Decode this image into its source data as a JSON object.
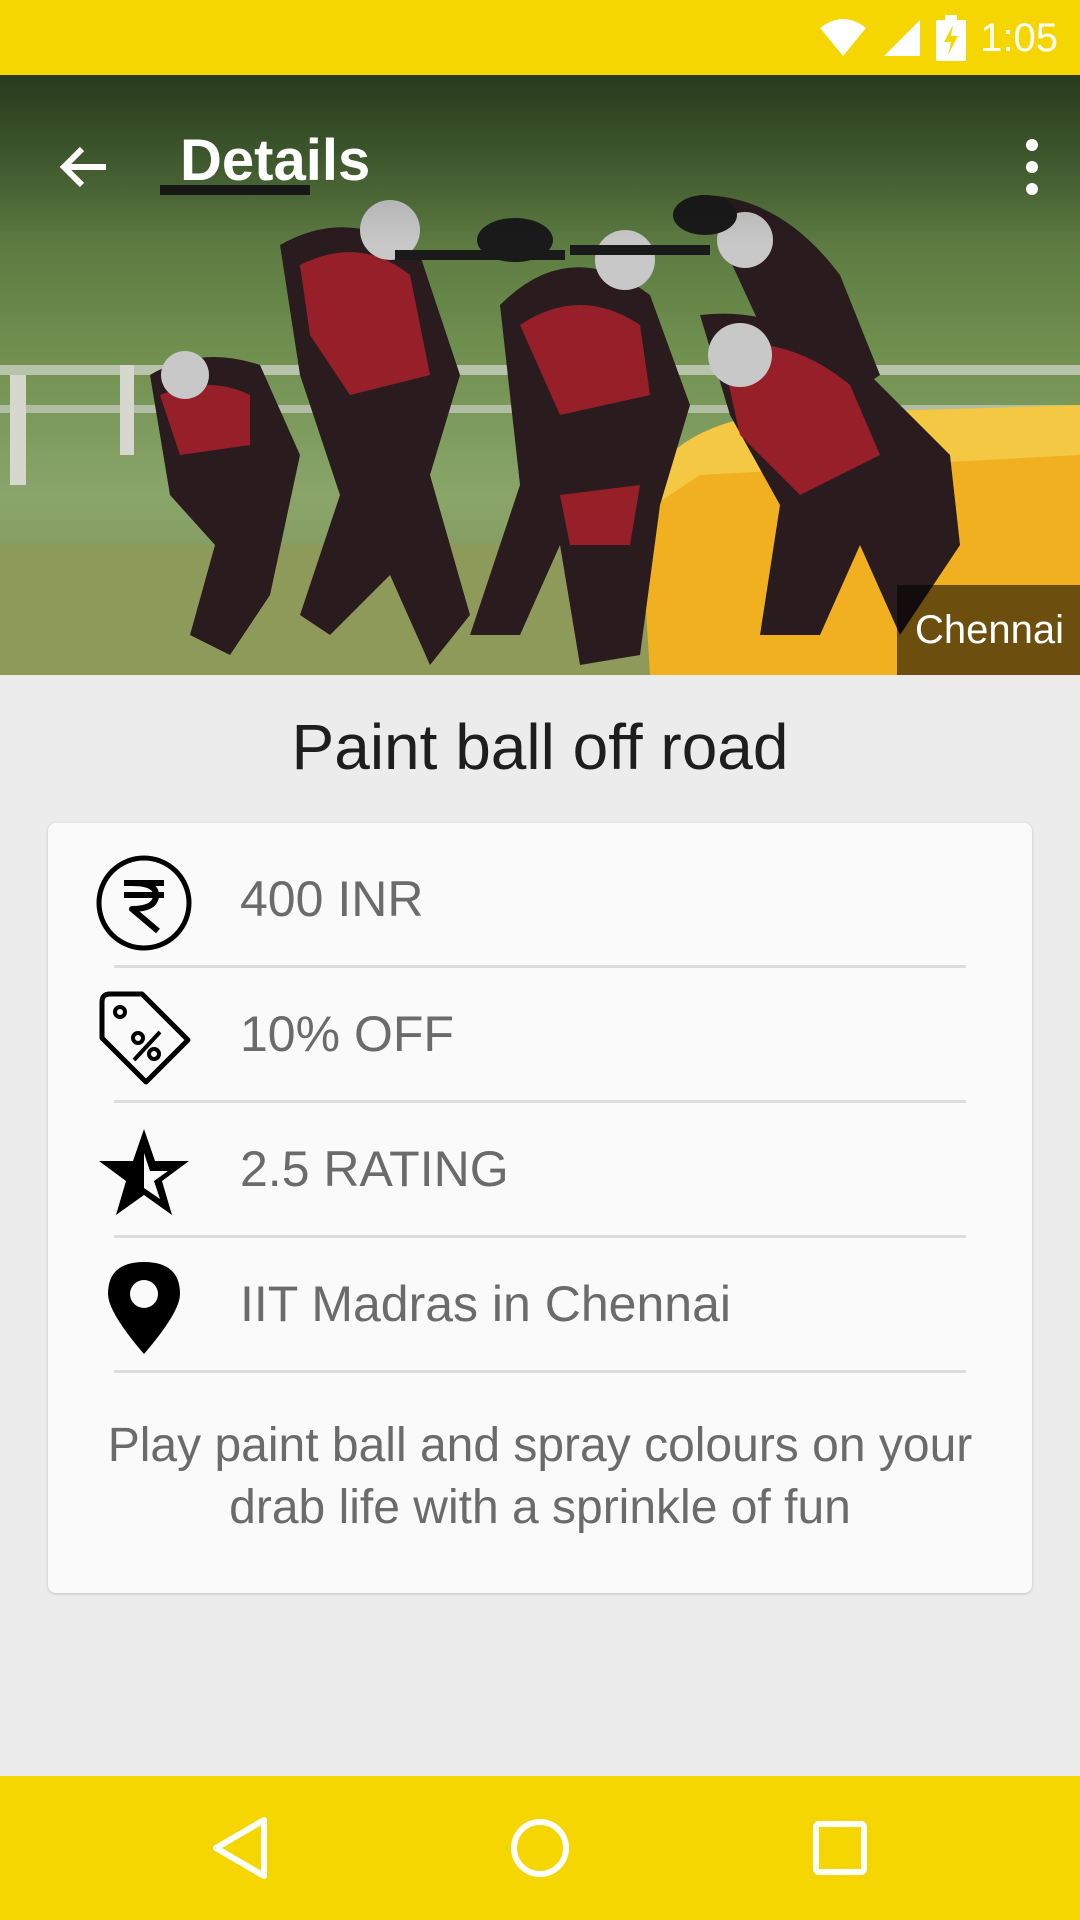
{
  "status_bar": {
    "time": "1:05",
    "icons": [
      "wifi-icon",
      "signal-icon",
      "battery-charging-icon"
    ],
    "color": "#f5d600"
  },
  "app_bar": {
    "title": "Details",
    "back_icon": "arrow-back-icon",
    "menu_icon": "more-vert-icon"
  },
  "hero": {
    "city": "Chennai"
  },
  "activity": {
    "title": "Paint ball off road",
    "details": [
      {
        "icon": "rupee-icon",
        "text": "400 INR"
      },
      {
        "icon": "discount-tag-icon",
        "text": "10% OFF"
      },
      {
        "icon": "star-half-icon",
        "text": "2.5 RATING"
      },
      {
        "icon": "location-pin-icon",
        "text": "IIT Madras in Chennai"
      }
    ],
    "description": "Play paint ball and spray colours on your drab life with a sprinkle of fun"
  },
  "nav_bar": {
    "buttons": [
      "nav-back-icon",
      "nav-home-icon",
      "nav-recents-icon"
    ],
    "color": "#f5d600"
  }
}
